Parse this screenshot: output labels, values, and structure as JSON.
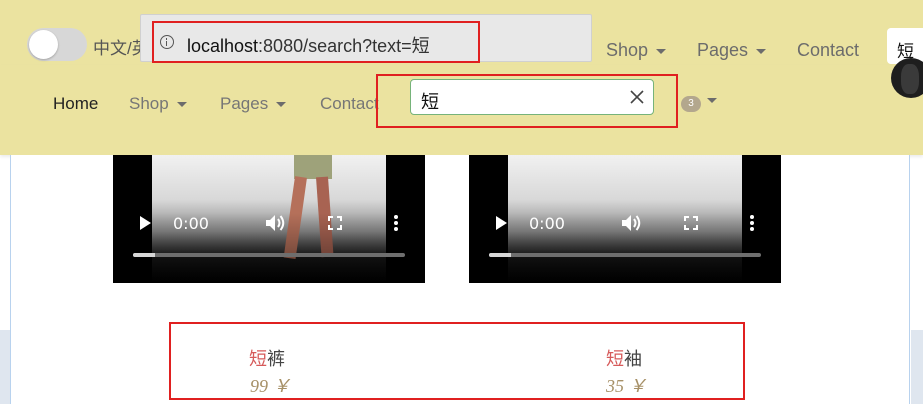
{
  "browser": {
    "url_host": "localhost",
    "url_rest": ":8080/search?text=短"
  },
  "back_nav": {
    "language_label": "中文/英",
    "links": [
      {
        "label": "Shop",
        "has_dropdown": true
      },
      {
        "label": "Pages",
        "has_dropdown": true
      },
      {
        "label": "Contact",
        "has_dropdown": false
      }
    ],
    "search_value": "短"
  },
  "nav": {
    "links": [
      {
        "label": "Home",
        "active": true
      },
      {
        "label": "Shop",
        "has_dropdown": true
      },
      {
        "label": "Pages",
        "has_dropdown": true
      },
      {
        "label": "Contact",
        "has_dropdown": false
      }
    ],
    "search": {
      "value": "短",
      "clear_icon": "close-icon"
    },
    "cart_badge": "3"
  },
  "videos": [
    {
      "time": "0:00",
      "progress": 0.08
    },
    {
      "time": "0:00",
      "progress": 0.08
    }
  ],
  "products": [
    {
      "highlight": "短",
      "rest": "裤",
      "price": "99 ￥"
    },
    {
      "highlight": "短",
      "rest": "袖",
      "price": "35 ￥"
    }
  ],
  "colors": {
    "navbar_bg": "#ebe3a0",
    "highlight": "#d65a5a",
    "price": "#a79168",
    "annotation_box": "#e02020"
  }
}
